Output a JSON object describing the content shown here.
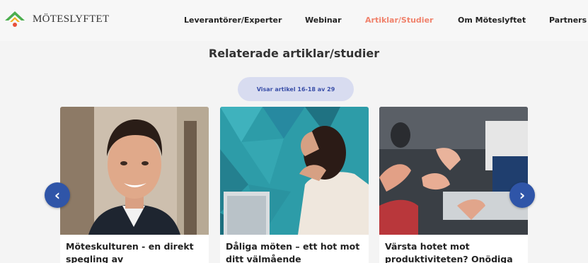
{
  "brand": {
    "name": "MÖTESLYFTET",
    "logo_icon": "house-roof-logo"
  },
  "nav": {
    "items": [
      {
        "label": "Leverantörer/Experter"
      },
      {
        "label": "Webinar"
      },
      {
        "label": "Artiklar/Studier",
        "active": true
      },
      {
        "label": "Om Möteslyftet"
      },
      {
        "label": "Partners"
      }
    ],
    "active_color": "#f0826c"
  },
  "section": {
    "title": "Relaterade artiklar/studier"
  },
  "pager": {
    "label": "Visar artikel 16-18 av 29"
  },
  "carousel": {
    "prev_icon": "chevron-left-icon",
    "next_icon": "chevron-right-icon",
    "cards": [
      {
        "title": "Möteskulturen - en direkt spegling av",
        "image": "smiling-man-portrait"
      },
      {
        "title": "Dåliga möten – ett hot mot ditt välmående",
        "image": "stressed-woman-at-laptop"
      },
      {
        "title": "Värsta hotet mot produktiviteten? Onödiga",
        "image": "hands-gesturing-meeting"
      }
    ]
  },
  "colors": {
    "accent": "#2f55a8",
    "pager_bg": "#d8dcf0",
    "logo_green": "#4cae4f",
    "logo_red": "#e8503a"
  }
}
